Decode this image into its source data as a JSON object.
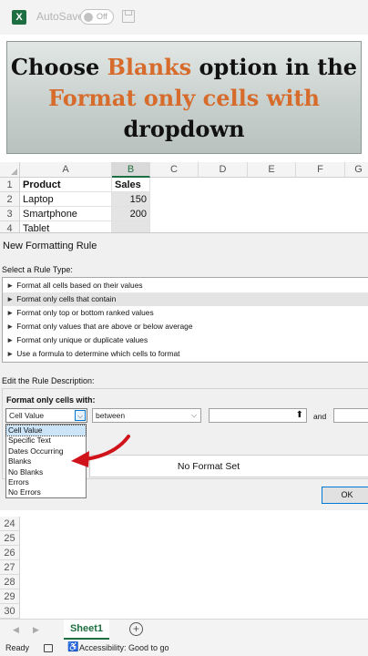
{
  "titlebar": {
    "logo": "X",
    "autosave_label": "AutoSave",
    "autosave_state": "Off"
  },
  "banner": {
    "line1_a": "Choose ",
    "line1_b": "Blanks",
    "line1_c": " option in the",
    "line2": "Format only cells with",
    "line3": "dropdown"
  },
  "sheet": {
    "columns": [
      "A",
      "B",
      "C",
      "D",
      "E",
      "F",
      "G"
    ],
    "rows": [
      {
        "num": "1",
        "a": "Product",
        "b": "Sales"
      },
      {
        "num": "2",
        "a": "Laptop",
        "b": "150"
      },
      {
        "num": "3",
        "a": "Smartphone",
        "b": "200"
      },
      {
        "num": "4",
        "a": "Tablet",
        "b": ""
      }
    ],
    "lower_rows": [
      "24",
      "25",
      "26",
      "27",
      "28",
      "29",
      "30"
    ]
  },
  "dialog": {
    "title": "New Formatting Rule",
    "rule_type_label": "Select a Rule Type:",
    "rule_types": [
      "Format all cells based on their values",
      "Format only cells that contain",
      "Format only top or bottom ranked values",
      "Format only values that are above or below average",
      "Format only unique or duplicate values",
      "Use a formula to determine which cells to format"
    ],
    "rule_bullet": "►",
    "description_label": "Edit the Rule Description:",
    "format_only_label": "Format only cells with:",
    "cell_type_value": "Cell Value",
    "operator_value": "between",
    "and_label": "and",
    "cell_type_options": [
      "Cell Value",
      "Specific Text",
      "Dates Occurring",
      "Blanks",
      "No Blanks",
      "Errors",
      "No Errors"
    ],
    "preview_text": "No Format Set",
    "ok_label": "OK",
    "picker_glyph": "⬆",
    "dropdown_glyph": "⌵"
  },
  "tabs": {
    "sheet1": "Sheet1",
    "add": "+",
    "prev": "◀",
    "next": "▶"
  },
  "status": {
    "ready": "Ready",
    "accessibility": "Accessibility: Good to go"
  },
  "colors": {
    "excel_green": "#1d6f42",
    "highlight_orange": "#d66b2b",
    "arrow_red": "#d0121b",
    "focus_blue": "#0078d7"
  }
}
